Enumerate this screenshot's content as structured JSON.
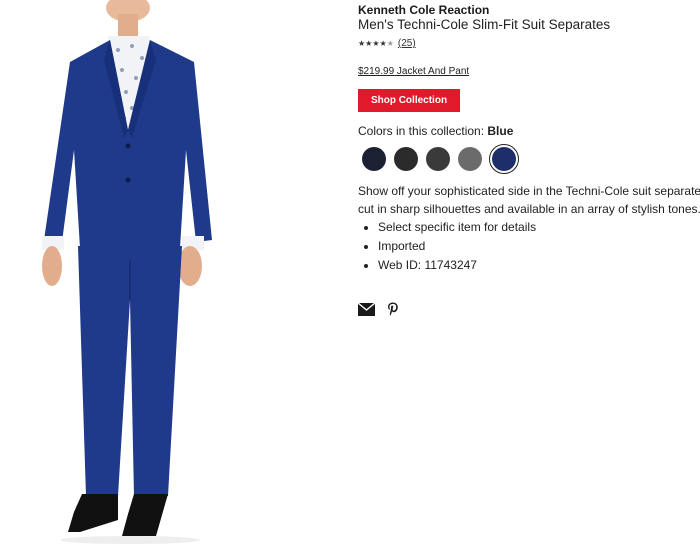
{
  "product": {
    "brand": "Kenneth Cole Reaction",
    "title": "Men's Techni-Cole Slim-Fit Suit Separates",
    "rating": 4.5,
    "review_count": "(25)",
    "price": "$219.99 Jacket And Pant",
    "shop_button": "Shop Collection",
    "colors_label": "Colors in this collection: ",
    "selected_color": "Blue",
    "description_line1": "Show off your sophisticated side in the Techni-Cole suit separates",
    "description_line2": "cut in sharp silhouettes and available in an array of stylish tones.",
    "bullets": [
      "Select specific item for details",
      "Imported",
      "Web ID: 11743247"
    ]
  },
  "swatches": [
    {
      "name": "navy-dark",
      "color": "#1b2033",
      "selected": false
    },
    {
      "name": "charcoal",
      "color": "#2b2b2b",
      "selected": false
    },
    {
      "name": "dark-gray",
      "color": "#3a3a3a",
      "selected": false
    },
    {
      "name": "gray",
      "color": "#6b6b6b",
      "selected": false
    },
    {
      "name": "blue",
      "color": "#1d2f6b",
      "selected": true
    }
  ],
  "share_icons": [
    "email-icon",
    "pinterest-icon"
  ],
  "colors": {
    "accent": "#e11a2b",
    "suit_blue": "#1f3a8a"
  }
}
